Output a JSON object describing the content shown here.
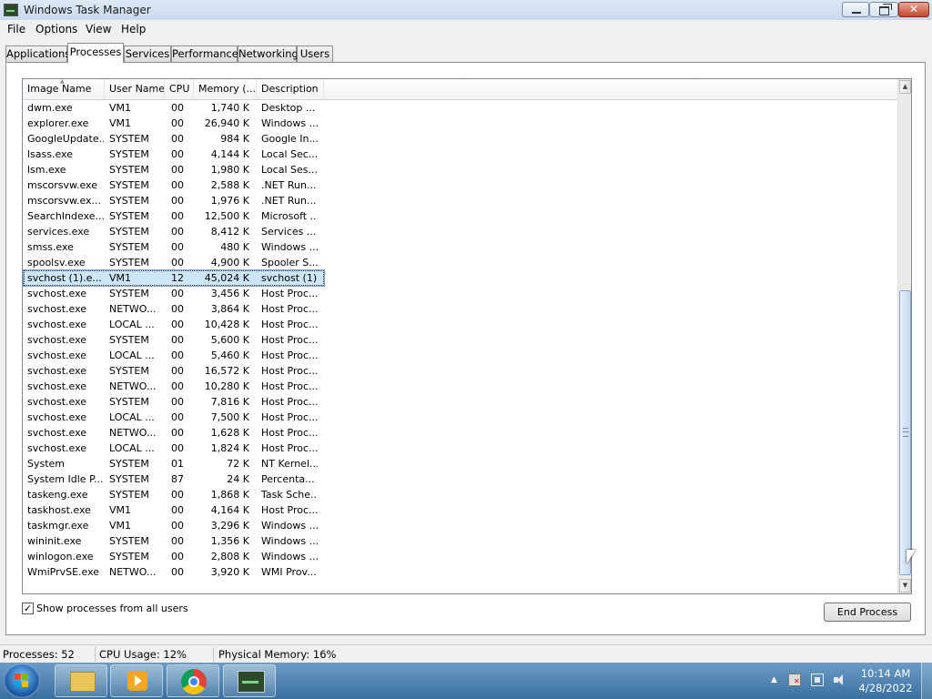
{
  "window": {
    "title": "Windows Task Manager"
  },
  "menu": [
    "File",
    "Options",
    "View",
    "Help"
  ],
  "tabs": [
    "Applications",
    "Processes",
    "Services",
    "Performance",
    "Networking",
    "Users"
  ],
  "active_tab": "Processes",
  "columns": [
    "Image Name",
    "User Name",
    "CPU",
    "Memory (...",
    "Description"
  ],
  "processes": [
    {
      "name": "dwm.exe",
      "user": "VM1",
      "cpu": "00",
      "mem": "1,740 K",
      "desc": "Desktop ..."
    },
    {
      "name": "explorer.exe",
      "user": "VM1",
      "cpu": "00",
      "mem": "26,940 K",
      "desc": "Windows ..."
    },
    {
      "name": "GoogleUpdate...",
      "user": "SYSTEM",
      "cpu": "00",
      "mem": "984 K",
      "desc": "Google In..."
    },
    {
      "name": "lsass.exe",
      "user": "SYSTEM",
      "cpu": "00",
      "mem": "4,144 K",
      "desc": "Local Sec..."
    },
    {
      "name": "lsm.exe",
      "user": "SYSTEM",
      "cpu": "00",
      "mem": "1,980 K",
      "desc": "Local Ses..."
    },
    {
      "name": "mscorsvw.exe",
      "user": "SYSTEM",
      "cpu": "00",
      "mem": "2,588 K",
      "desc": ".NET Run..."
    },
    {
      "name": "mscorsvw.ex...",
      "user": "SYSTEM",
      "cpu": "00",
      "mem": "1,976 K",
      "desc": ".NET Run..."
    },
    {
      "name": "SearchIndexe...",
      "user": "SYSTEM",
      "cpu": "00",
      "mem": "12,500 K",
      "desc": "Microsoft ..."
    },
    {
      "name": "services.exe",
      "user": "SYSTEM",
      "cpu": "00",
      "mem": "8,412 K",
      "desc": "Services ..."
    },
    {
      "name": "smss.exe",
      "user": "SYSTEM",
      "cpu": "00",
      "mem": "480 K",
      "desc": "Windows ..."
    },
    {
      "name": "spoolsv.exe",
      "user": "SYSTEM",
      "cpu": "00",
      "mem": "4,900 K",
      "desc": "Spooler S..."
    },
    {
      "name": "svchost (1).e...",
      "user": "VM1",
      "cpu": "12",
      "mem": "45,024 K",
      "desc": "svchost (1)",
      "selected": true
    },
    {
      "name": "svchost.exe",
      "user": "SYSTEM",
      "cpu": "00",
      "mem": "3,456 K",
      "desc": "Host Proc..."
    },
    {
      "name": "svchost.exe",
      "user": "NETWO...",
      "cpu": "00",
      "mem": "3,864 K",
      "desc": "Host Proc..."
    },
    {
      "name": "svchost.exe",
      "user": "LOCAL ...",
      "cpu": "00",
      "mem": "10,428 K",
      "desc": "Host Proc..."
    },
    {
      "name": "svchost.exe",
      "user": "SYSTEM",
      "cpu": "00",
      "mem": "5,600 K",
      "desc": "Host Proc..."
    },
    {
      "name": "svchost.exe",
      "user": "LOCAL ...",
      "cpu": "00",
      "mem": "5,460 K",
      "desc": "Host Proc..."
    },
    {
      "name": "svchost.exe",
      "user": "SYSTEM",
      "cpu": "00",
      "mem": "16,572 K",
      "desc": "Host Proc..."
    },
    {
      "name": "svchost.exe",
      "user": "NETWO...",
      "cpu": "00",
      "mem": "10,280 K",
      "desc": "Host Proc..."
    },
    {
      "name": "svchost.exe",
      "user": "SYSTEM",
      "cpu": "00",
      "mem": "7,816 K",
      "desc": "Host Proc..."
    },
    {
      "name": "svchost.exe",
      "user": "LOCAL ...",
      "cpu": "00",
      "mem": "7,500 K",
      "desc": "Host Proc..."
    },
    {
      "name": "svchost.exe",
      "user": "NETWO...",
      "cpu": "00",
      "mem": "1,628 K",
      "desc": "Host Proc..."
    },
    {
      "name": "svchost.exe",
      "user": "LOCAL ...",
      "cpu": "00",
      "mem": "1,824 K",
      "desc": "Host Proc..."
    },
    {
      "name": "System",
      "user": "SYSTEM",
      "cpu": "01",
      "mem": "72 K",
      "desc": "NT Kernel..."
    },
    {
      "name": "System Idle P...",
      "user": "SYSTEM",
      "cpu": "87",
      "mem": "24 K",
      "desc": "Percenta..."
    },
    {
      "name": "taskeng.exe",
      "user": "SYSTEM",
      "cpu": "00",
      "mem": "1,868 K",
      "desc": "Task Sche..."
    },
    {
      "name": "taskhost.exe",
      "user": "VM1",
      "cpu": "00",
      "mem": "4,164 K",
      "desc": "Host Proc..."
    },
    {
      "name": "taskmgr.exe",
      "user": "VM1",
      "cpu": "00",
      "mem": "3,296 K",
      "desc": "Windows ..."
    },
    {
      "name": "wininit.exe",
      "user": "SYSTEM",
      "cpu": "00",
      "mem": "1,356 K",
      "desc": "Windows ..."
    },
    {
      "name": "winlogon.exe",
      "user": "SYSTEM",
      "cpu": "00",
      "mem": "2,808 K",
      "desc": "Windows ..."
    },
    {
      "name": "WmiPrvSE.exe",
      "user": "NETWO...",
      "cpu": "00",
      "mem": "3,920 K",
      "desc": "WMI Prov..."
    }
  ],
  "show_all_users": {
    "label": "Show processes from all users",
    "checked": true,
    "check_glyph": "✓"
  },
  "end_process_label": "End Process",
  "status": {
    "processes": "Processes: 52",
    "cpu": "CPU Usage: 12%",
    "memory": "Physical Memory: 16%"
  },
  "taskbar": {
    "apps": [
      "folder-icon",
      "media-player-icon",
      "chrome-icon",
      "task-manager-icon"
    ],
    "time": "10:14 AM",
    "date": "4/28/2022",
    "tray_arrow": "▲"
  },
  "icons": {
    "close": "✕",
    "scroll_up": "▲",
    "scroll_down": "▼",
    "sort": "▲"
  }
}
